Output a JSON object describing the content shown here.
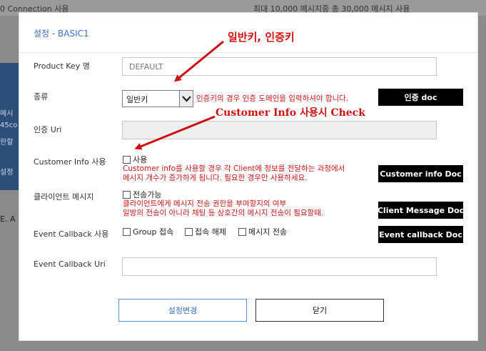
{
  "background": {
    "top_left": "0 Connection 사용",
    "top_right": "최대 10,000 메시지중 총 30,000 메시지 사용",
    "band_lines": [
      "메시",
      "45co",
      "한할",
      "설정"
    ],
    "left_text": "E. A"
  },
  "modal": {
    "title": "설정 - BASIC1",
    "product_key": {
      "label": "Product Key 명",
      "value": "DEFAULT"
    },
    "type": {
      "label": "종류",
      "selected": "일반키",
      "hint": "인증키의 경우 인증 도메인을 입력하셔야 합니다.",
      "doc_button": "인증 doc"
    },
    "auth_uri": {
      "label": "인증 Uri",
      "value": ""
    },
    "customer_info": {
      "label": "Customer Info 사용",
      "checkbox": "사용",
      "hint_line1": "Customer info를 사용할 경우 각 Client에 정보를 전달하는 과정에서",
      "hint_line2": "메시지 개수가 증가하게 됩니다. 필요한 경우만 사용하세요.",
      "doc_button": "Customer info Doc"
    },
    "client_message": {
      "label": "클라이언트 메시지",
      "checkbox": "전송가능",
      "hint_line1": "클라이언트에게 메시지 전송 권한을 부여할지의 여부",
      "hint_line2": "일방의 전송이 아니라 채팅 등 상호간의 메시지 전송이 필요할때.",
      "doc_button": "Client Message Doc"
    },
    "event_callback": {
      "label": "Event Callback 사용",
      "options": [
        "Group 접속",
        "접속 해제",
        "메시지 전송"
      ],
      "doc_button": "Event callback Doc"
    },
    "event_callback_uri": {
      "label": "Event Callback Uri",
      "value": ""
    },
    "buttons": {
      "save": "설정변경",
      "close": "닫기"
    }
  },
  "annotations": {
    "key_types": "일반키, 인증키",
    "customer_info_check": "Customer Info 사용시 Check"
  },
  "colors": {
    "title": "#3b6fbf",
    "hint_red": "#c0191b",
    "annotation_red": "#cc1111",
    "doc_button_bg": "#000000"
  }
}
